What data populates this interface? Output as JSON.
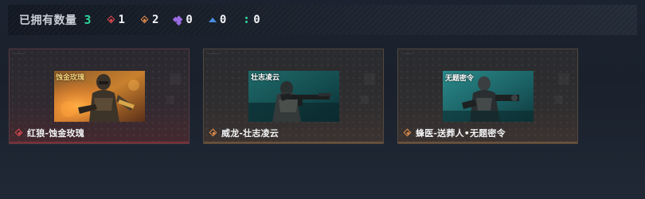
{
  "summary": {
    "owned_label": "已拥有数量",
    "owned_count": "3",
    "rarities": [
      {
        "icon": "red-diamond-icon",
        "color": "#e0474e",
        "count": "1"
      },
      {
        "icon": "orange-diamond-icon",
        "color": "#e08a4a",
        "count": "2"
      },
      {
        "icon": "purple-gem-icon",
        "color": "#9a6be0",
        "count": "0"
      },
      {
        "icon": "blue-arrow-icon",
        "color": "#4a8de0",
        "count": "0"
      },
      {
        "icon": "green-dots-icon",
        "color": "#2fd39a",
        "count": "0"
      }
    ]
  },
  "cards": [
    {
      "name": "红狼-蚀金玫瑰",
      "rarity_color": "#e0474e",
      "thumb_text": "蚀金玫瑰",
      "style": "red"
    },
    {
      "name": "威龙-壮志凌云",
      "rarity_color": "#e08a4a",
      "thumb_text": "壮志凌云",
      "style": "orange"
    },
    {
      "name": "蜂医-送葬人•无题密令",
      "rarity_color": "#e08a4a",
      "thumb_text": "无题密令",
      "style": "orange"
    }
  ]
}
